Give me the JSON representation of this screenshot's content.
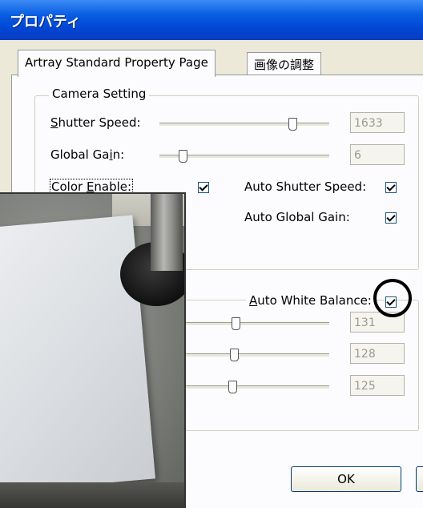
{
  "window": {
    "title": "プロパティ"
  },
  "tabs": [
    {
      "label": "Artray Standard Property Page",
      "active": true
    },
    {
      "label": "画像の調整",
      "active": false
    }
  ],
  "camera_setting": {
    "legend": "Camera Setting",
    "shutter_speed": {
      "label_underlined": "S",
      "label_rest": "hutter Speed:",
      "value": "1633",
      "level_percent": 80
    },
    "global_gain": {
      "label_start": "Global Ga",
      "label_underlined": "i",
      "label_rest": "n:",
      "value": "6",
      "level_percent": 12
    },
    "color_enable": {
      "label_start": "Color ",
      "label_underlined": "E",
      "label_rest": "nable:",
      "checked": true
    },
    "auto_shutter_speed": {
      "label": "Auto Shutter Speed:",
      "checked": true
    },
    "auto_global_gain": {
      "label": "Auto Global Gain:",
      "checked": true
    }
  },
  "white_balance": {
    "auto_white_balance": {
      "label_underlined": "A",
      "label_rest": "uto White Balance:",
      "checked": true
    },
    "sliders": [
      {
        "value": "131",
        "level_percent": 45
      },
      {
        "value": "128",
        "level_percent": 44
      },
      {
        "value": "125",
        "level_percent": 43
      }
    ]
  },
  "buttons": {
    "ok": "OK"
  },
  "colors": {
    "title_bar": "#0a5fe3",
    "panel": "#fcfcfe",
    "window_bg": "#ece9d8"
  }
}
